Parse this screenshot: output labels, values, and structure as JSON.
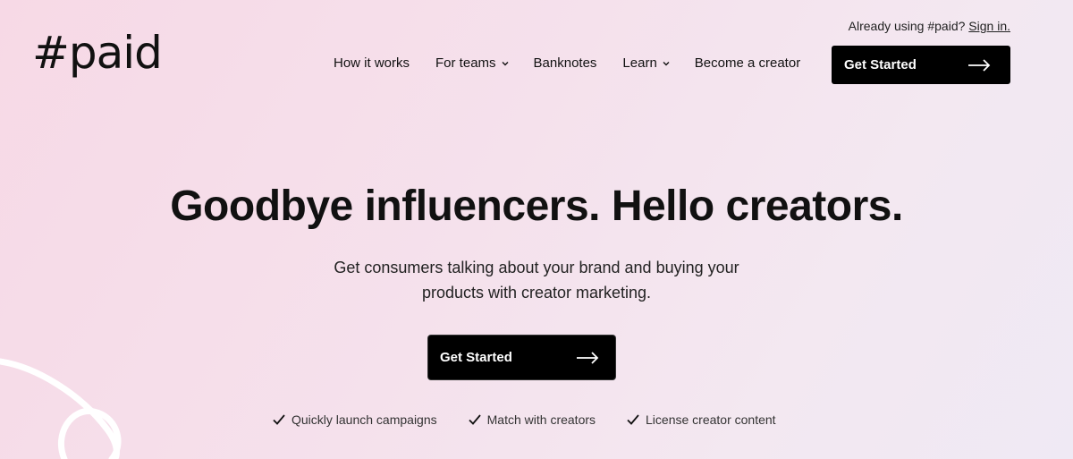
{
  "header": {
    "logo": "#paid",
    "signin_prefix": "Already using #paid?",
    "signin_link": "Sign in.",
    "nav": [
      {
        "label": "How it works",
        "has_dropdown": false
      },
      {
        "label": "For teams",
        "has_dropdown": true
      },
      {
        "label": "Banknotes",
        "has_dropdown": false
      },
      {
        "label": "Learn",
        "has_dropdown": true
      },
      {
        "label": "Become a creator",
        "has_dropdown": false
      }
    ],
    "cta_label": "Get Started"
  },
  "hero": {
    "headline": "Goodbye influencers. Hello creators.",
    "subhead_line1": "Get consumers talking about your brand and buying your",
    "subhead_line2": "products with creator marketing.",
    "cta_label": "Get Started",
    "features": [
      {
        "label": "Quickly launch campaigns",
        "icon": "check-icon"
      },
      {
        "label": "Match with creators",
        "icon": "check-icon"
      },
      {
        "label": "License creator content",
        "icon": "check-icon"
      }
    ]
  },
  "colors": {
    "background_start": "#f7d9e6",
    "background_end": "#efe9f4",
    "button": "#000000",
    "text": "#111111"
  }
}
